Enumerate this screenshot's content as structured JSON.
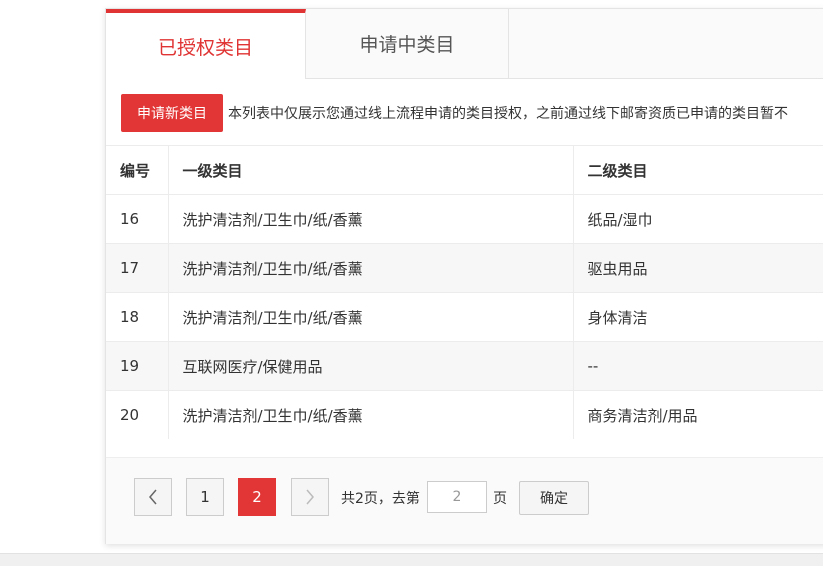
{
  "tabs": [
    {
      "label": "已授权类目",
      "active": true
    },
    {
      "label": "申请中类目",
      "active": false
    }
  ],
  "toolbar": {
    "apply_label": "申请新类目",
    "notice": "本列表中仅展示您通过线上流程申请的类目授权，之前通过线下邮寄资质已申请的类目暂不"
  },
  "table": {
    "headers": [
      "编号",
      "一级类目",
      "二级类目"
    ],
    "rows": [
      [
        "16",
        "洗护清洁剂/卫生巾/纸/香薰",
        "纸品/湿巾"
      ],
      [
        "17",
        "洗护清洁剂/卫生巾/纸/香薰",
        "驱虫用品"
      ],
      [
        "18",
        "洗护清洁剂/卫生巾/纸/香薰",
        "身体清洁"
      ],
      [
        "19",
        "互联网医疗/保健用品",
        "--"
      ],
      [
        "20",
        "洗护清洁剂/卫生巾/纸/香薰",
        "商务清洁剂/用品"
      ]
    ]
  },
  "pager": {
    "prev_icon": "chevron-left-icon",
    "next_icon": "chevron-right-icon",
    "pages": [
      "1",
      "2"
    ],
    "current_page": "2",
    "total_text": "共2页，去第",
    "goto_value": "2",
    "page_suffix": "页",
    "confirm_label": "确定"
  },
  "colors": {
    "accent": "#e23535"
  }
}
